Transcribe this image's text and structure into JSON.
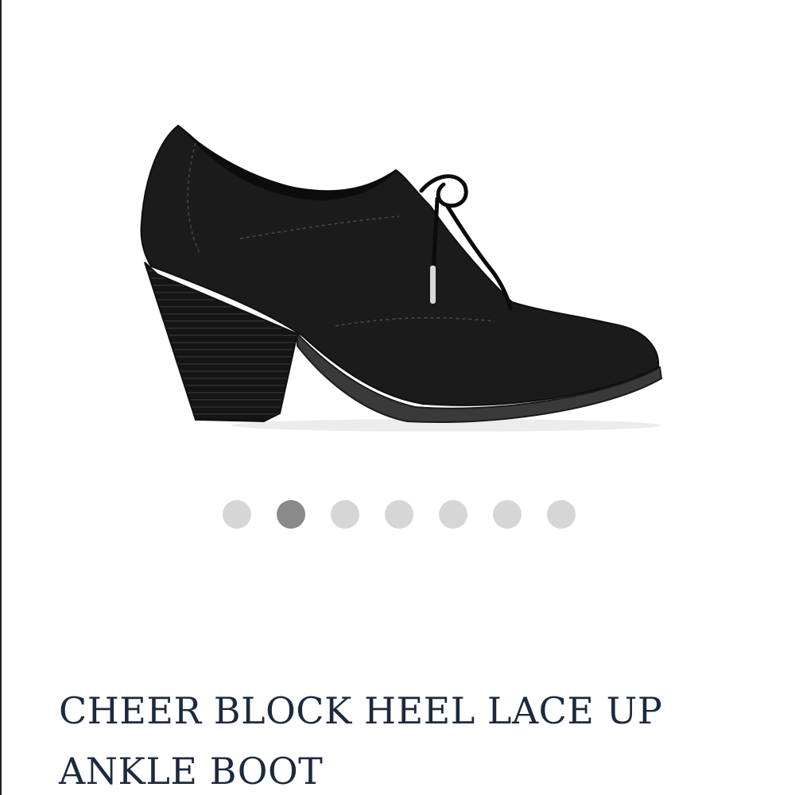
{
  "product": {
    "image": {
      "icon": "black-suede-lace-up-block-heel-bootie"
    },
    "title": "CHEER BLOCK HEEL LACE UP ANKLE BOOT"
  },
  "carousel": {
    "count": 7,
    "active_index": 1,
    "colors": {
      "inactive": "#d6d6d6",
      "active": "#8a8a8a"
    }
  },
  "colors": {
    "title": "#1c2a3e"
  }
}
